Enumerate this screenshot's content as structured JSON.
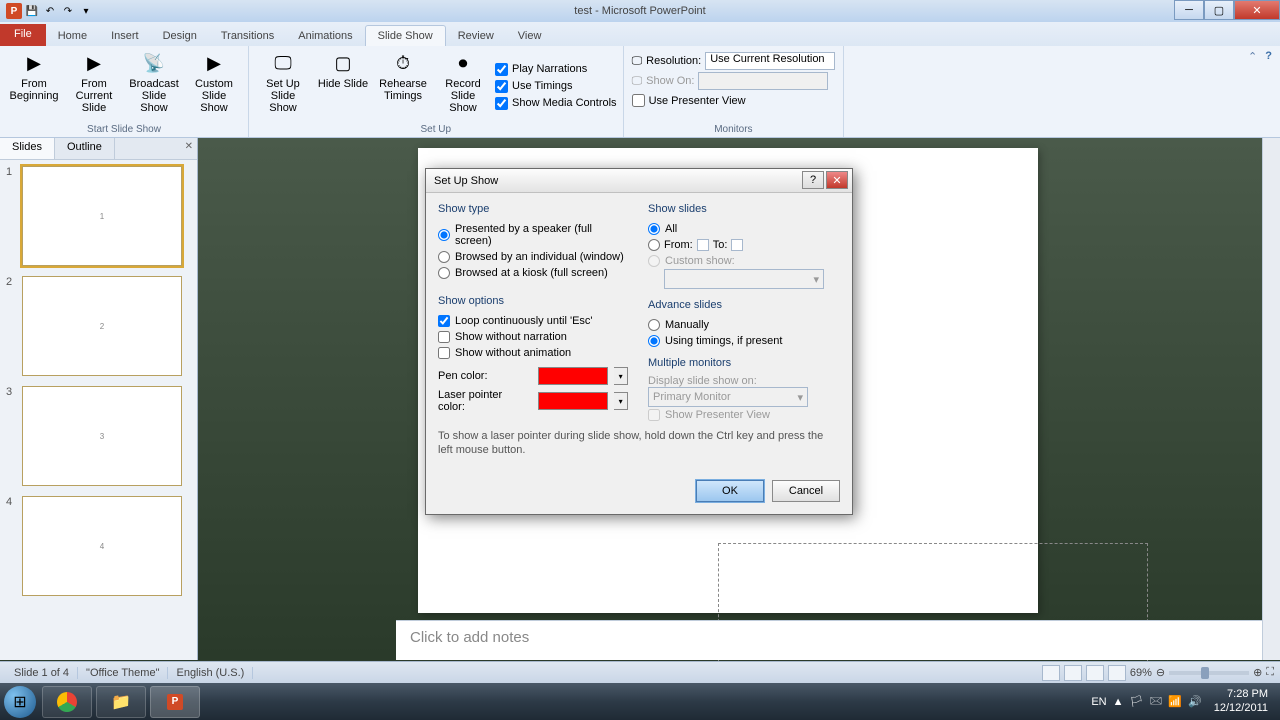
{
  "title": "test - Microsoft PowerPoint",
  "tabs": {
    "file": "File",
    "home": "Home",
    "insert": "Insert",
    "design": "Design",
    "transitions": "Transitions",
    "animations": "Animations",
    "slideshow": "Slide Show",
    "review": "Review",
    "view": "View"
  },
  "ribbon": {
    "from_beginning": "From Beginning",
    "from_current": "From Current Slide",
    "broadcast": "Broadcast Slide Show",
    "custom": "Custom Slide Show",
    "setup": "Set Up Slide Show",
    "hide": "Hide Slide",
    "rehearse": "Rehearse Timings",
    "record": "Record Slide Show",
    "play_narr": "Play Narrations",
    "use_timings": "Use Timings",
    "show_media": "Show Media Controls",
    "resolution": "Resolution:",
    "res_val": "Use Current Resolution",
    "show_on": "Show On:",
    "use_presenter": "Use Presenter View",
    "g_start": "Start Slide Show",
    "g_setup": "Set Up",
    "g_mon": "Monitors"
  },
  "panel": {
    "slides": "Slides",
    "outline": "Outline",
    "thumbs": [
      "1",
      "2",
      "3",
      "4"
    ]
  },
  "notes": "Click to add notes",
  "status": {
    "slide": "Slide 1 of 4",
    "theme": "\"Office Theme\"",
    "lang": "English (U.S.)",
    "zoom": "69%"
  },
  "tray": {
    "lang": "EN",
    "time": "7:28 PM",
    "date": "12/12/2011"
  },
  "dialog": {
    "title": "Set Up Show",
    "show_type": "Show type",
    "presented": "Presented by a speaker (full screen)",
    "browsed_ind": "Browsed by an individual (window)",
    "browsed_kiosk": "Browsed at a kiosk (full screen)",
    "show_options": "Show options",
    "loop": "Loop continuously until 'Esc'",
    "no_narr": "Show without narration",
    "no_anim": "Show without animation",
    "pen": "Pen color:",
    "laser": "Laser pointer color:",
    "show_slides": "Show slides",
    "all": "All",
    "from": "From:",
    "to": "To:",
    "custom_show": "Custom show:",
    "advance": "Advance slides",
    "manually": "Manually",
    "using_timings": "Using timings, if present",
    "multimon": "Multiple monitors",
    "display_on": "Display slide show on:",
    "primary": "Primary Monitor",
    "show_pv": "Show Presenter View",
    "hint": "To show a laser pointer during slide show, hold down the Ctrl key and press the left mouse button.",
    "ok": "OK",
    "cancel": "Cancel"
  }
}
